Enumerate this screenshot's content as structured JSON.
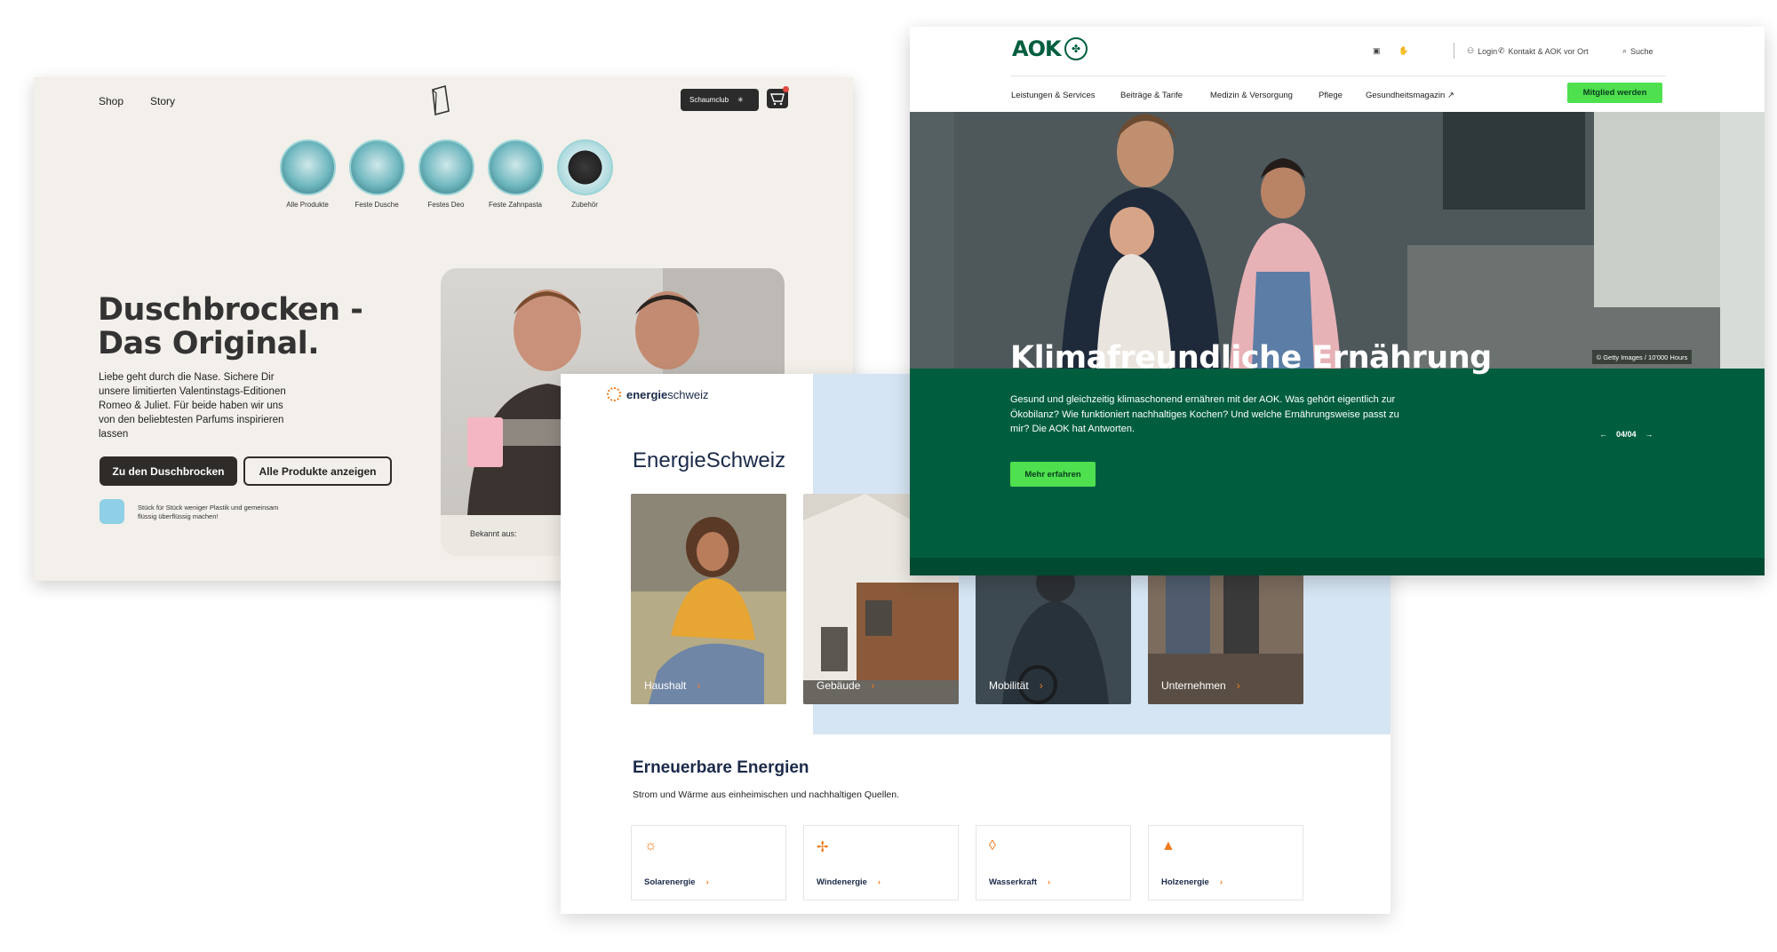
{
  "duschbrocken": {
    "nav": {
      "shop": "Shop",
      "story": "Story"
    },
    "schaumclub": "Schaumclub",
    "categories": [
      "Alle Produkte",
      "Feste Dusche",
      "Festes Deo",
      "Feste Zahnpasta",
      "Zubehör"
    ],
    "headline_line1": "Duschbrocken -",
    "headline_line2": "Das Original.",
    "intro": "Liebe geht durch die Nase. Sichere Dir unsere limitierten Valentinstags-Editionen Romeo & Juliet. Für beide haben wir uns von den beliebtesten Parfums inspirieren lassen",
    "btn_primary": "Zu den Duschbrocken",
    "btn_secondary": "Alle Produkte anzeigen",
    "badge_text": "Stück für Stück weniger Plastik und gemeinsam flüssig überflüssig machen!",
    "bekannt": "Bekannt aus:"
  },
  "energieschweiz": {
    "logo_bold": "energie",
    "logo_regular": "schweiz",
    "title": "EnergieSchweiz",
    "cards": [
      "Haushalt",
      "Gebäude",
      "Mobilität",
      "Unternehmen"
    ],
    "section_title": "Erneuerbare Energien",
    "section_sub": "Strom und Wärme aus einheimischen und nachhaltigen Quellen.",
    "tiles": [
      "Solarenergie",
      "Windenergie",
      "Wasserkraft",
      "Holzenergie"
    ],
    "chevron": "›",
    "accent": "#ef7c1e"
  },
  "aok": {
    "logo": "AOK",
    "util": {
      "login": "Login",
      "contact": "Kontakt & AOK vor Ort",
      "search": "Suche"
    },
    "nav": [
      "Leistungen & Services",
      "Beiträge & Tarife",
      "Medizin & Versorgung",
      "Pflege",
      "Gesundheitsmagazin ↗"
    ],
    "cta": "Mitglied werden",
    "headline": "Klimafreundliche Ernährung",
    "credit": "© Getty Images / 10'000 Hours",
    "description": "Gesund und gleichzeitig klimaschonend ernähren mit der AOK. Was gehört eigentlich zur Ökobilanz? Wie funktioniert nachhaltiges Kochen? Und welche Ernährungsweise passt zu mir? Die AOK hat Antworten.",
    "pager": "04/04",
    "button": "Mehr erfahren",
    "brand_green": "#005e3f",
    "cta_green": "#4ee04e"
  }
}
